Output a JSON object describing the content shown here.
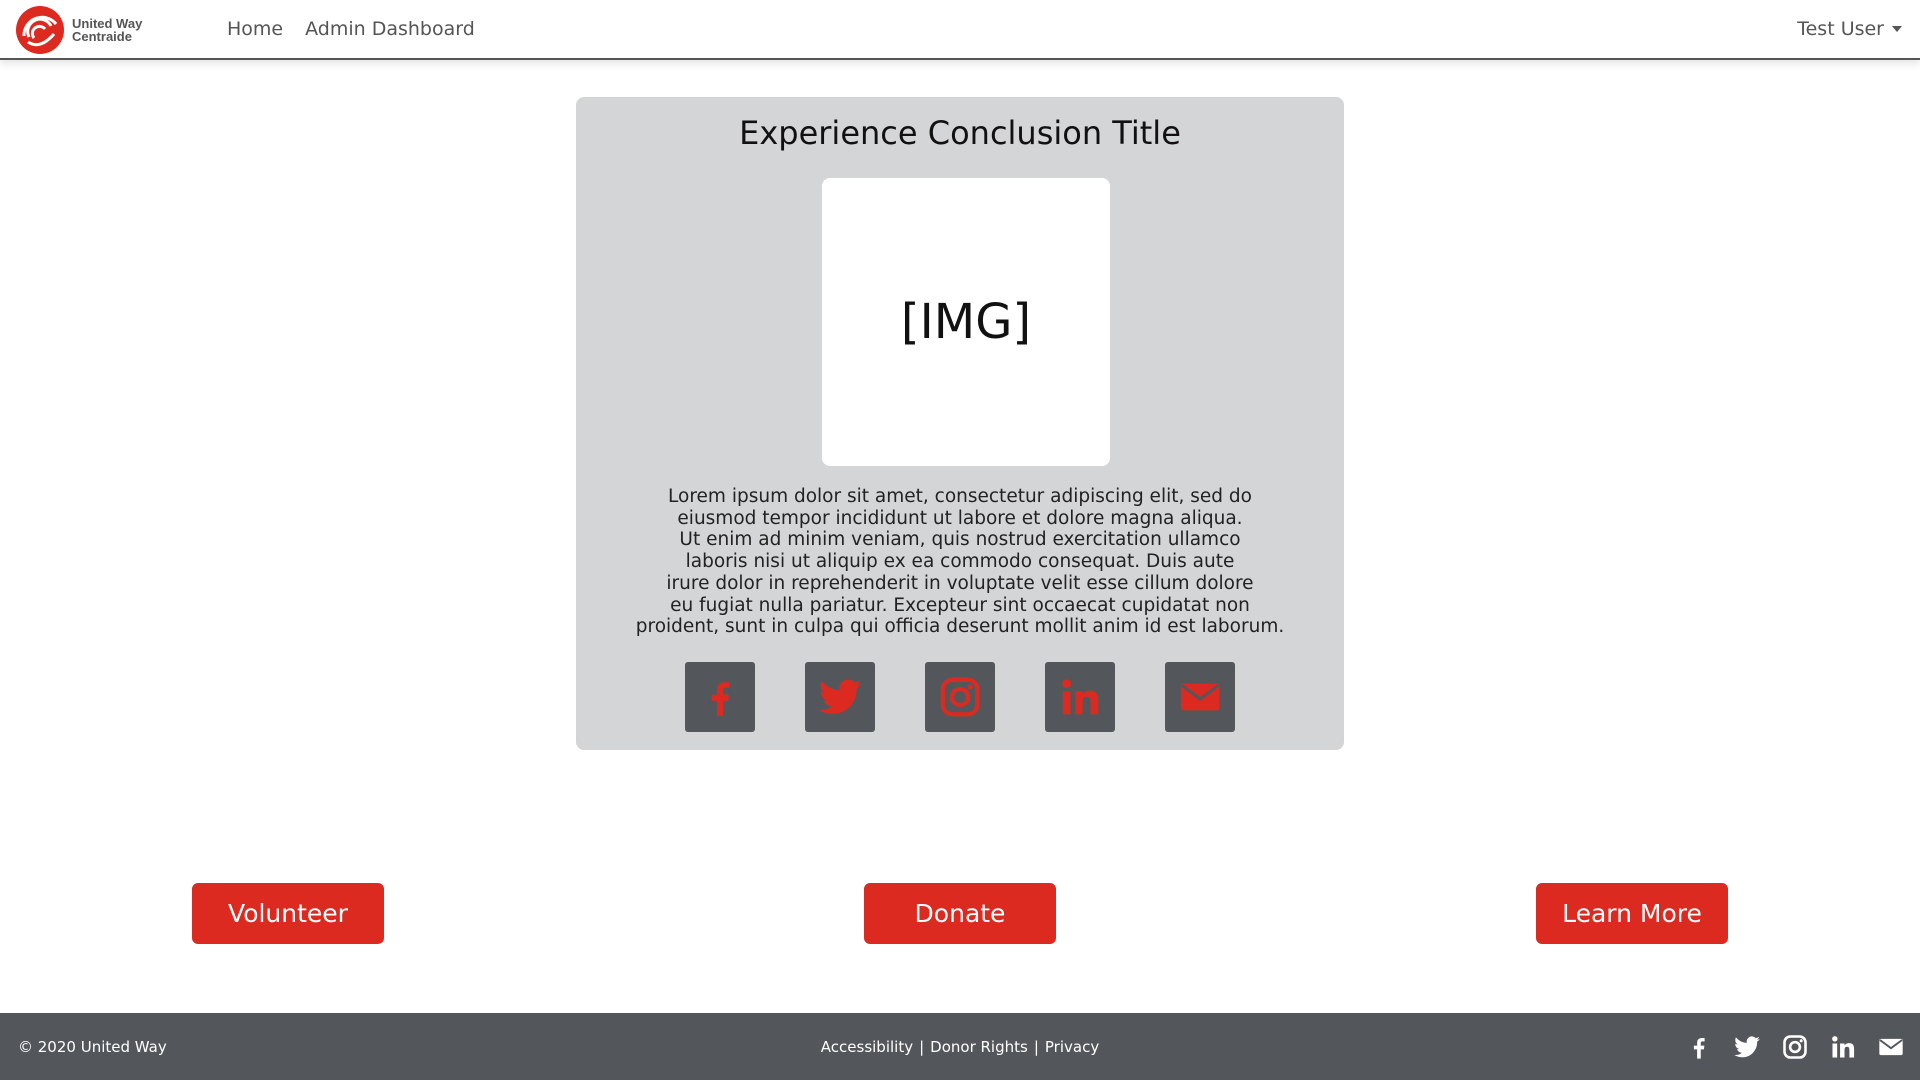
{
  "header": {
    "logo_text_line1": "United Way",
    "logo_text_line2": "Centraide",
    "nav": [
      "Home",
      "Admin Dashboard"
    ],
    "user_name": "Test User"
  },
  "card": {
    "title": "Experience Conclusion Title",
    "image_placeholder": "[IMG]",
    "body_lines": [
      "Lorem ipsum dolor sit amet, consectetur adipiscing elit, sed do",
      "eiusmod tempor incididunt ut labore et dolore magna aliqua.",
      "Ut enim ad minim veniam, quis nostrud exercitation ullamco",
      "laboris nisi ut aliquip ex ea commodo consequat. Duis aute",
      "irure dolor in reprehenderit in voluptate velit esse cillum dolore",
      "eu fugiat nulla pariatur. Excepteur sint occaecat cupidatat non",
      "proident, sunt in culpa qui officia deserunt mollit anim id est laborum."
    ],
    "share_icons": [
      "facebook-icon",
      "twitter-icon",
      "instagram-icon",
      "linkedin-icon",
      "email-icon"
    ]
  },
  "cta": {
    "volunteer": "Volunteer",
    "donate": "Donate",
    "learn_more": "Learn More"
  },
  "footer": {
    "copyright": "© 2020 United Way",
    "links": [
      "Accessibility",
      "Donor Rights",
      "Privacy"
    ],
    "separator": "|",
    "social_icons": [
      "facebook-icon",
      "twitter-icon",
      "instagram-icon",
      "linkedin-icon",
      "email-icon"
    ]
  },
  "colors": {
    "brand_red": "#dd2a21",
    "card_bg": "#d3d5d7",
    "dark_gray": "#53575b"
  }
}
